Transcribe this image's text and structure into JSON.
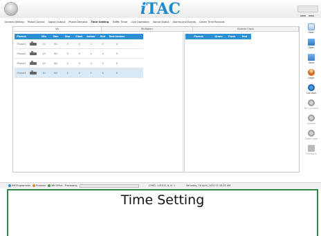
{
  "app": {
    "title_prefix": "i",
    "title_rest": "TAC"
  },
  "menu": [
    "General Setting",
    "Phase Control",
    "Signal Output",
    "Phase Demand",
    "Time Setting",
    "Traffic Timer",
    "Live Operation",
    "Signal Status",
    "Alarms and Events",
    "Green Time Records"
  ],
  "menu_active_index": 4,
  "tabs": [
    "VA",
    "Multiplan",
    "System Clock"
  ],
  "phase_table": {
    "columns": [
      "Phases",
      "",
      "Min",
      "Max",
      "Gap",
      "Flash",
      "Amber",
      "Red",
      "Red+Amber"
    ],
    "rows": [
      {
        "name": "Phase1",
        "min": "10",
        "max": "60",
        "gap": "3",
        "flash": "3",
        "amber": "2",
        "red": "3",
        "red_amber": "0"
      },
      {
        "name": "Phase2",
        "min": "10",
        "max": "60",
        "gap": "3",
        "flash": "3",
        "amber": "1",
        "red": "3",
        "red_amber": "0"
      },
      {
        "name": "Phase3",
        "min": "10",
        "max": "60",
        "gap": "3",
        "flash": "3",
        "amber": "3",
        "red": "3",
        "red_amber": "0"
      },
      {
        "name": "Phase4",
        "min": "10",
        "max": "60",
        "gap": "3",
        "flash": "3",
        "amber": "2",
        "red": "3",
        "red_amber": "0"
      }
    ],
    "selected_row": 3
  },
  "right_table": {
    "columns": [
      "Phases",
      "Green",
      "Flash",
      "Red"
    ]
  },
  "sidebar": [
    {
      "label": "New",
      "icon": "new-file-icon",
      "enabled": true
    },
    {
      "label": "Open",
      "icon": "open-folder-icon",
      "enabled": true
    },
    {
      "label": "Save",
      "icon": "save-icon",
      "enabled": true
    },
    {
      "label": "Login",
      "icon": "login-user-icon",
      "enabled": true
    },
    {
      "label": "Connect",
      "icon": "connect-icon",
      "enabled": true
    },
    {
      "label": "Dis Connect",
      "icon": "disconnect-icon",
      "enabled": false
    },
    {
      "label": "Update",
      "icon": "update-icon",
      "enabled": false
    },
    {
      "label": "Down load",
      "icon": "download-icon",
      "enabled": false
    },
    {
      "label": "Firmware",
      "icon": "firmware-icon",
      "enabled": false
    }
  ],
  "status": {
    "programmer": "XM Programmer",
    "user": "Rudasar",
    "office": "XM Office",
    "processing": "Processing",
    "port": "COM3, 115200, 8, N, 1",
    "datetime": "Saturday, 18 April, 2020   11:18:21 AM"
  },
  "caption": "Time Setting"
}
